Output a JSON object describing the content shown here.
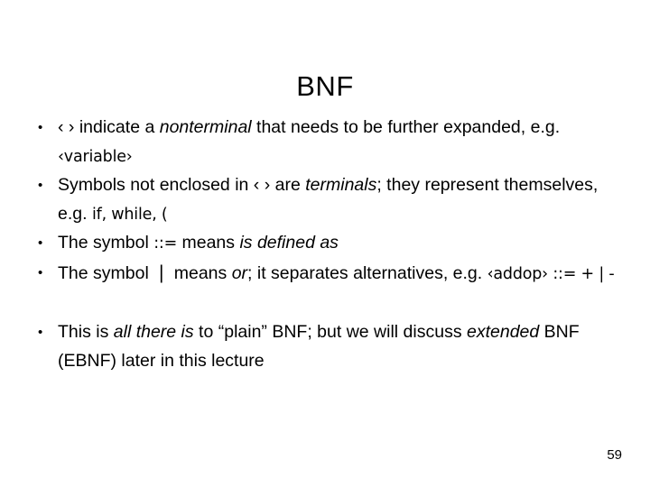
{
  "slide": {
    "title": "BNF",
    "page_number": "59",
    "background_color": "#ffffff",
    "text_color": "#000000"
  },
  "bullets": [
    {
      "id": "bullet-angle-brackets",
      "segments": [
        {
          "text": "‹ › ",
          "style": "angles"
        },
        {
          "text": "indicate a ",
          "style": "normal"
        },
        {
          "text": "nonterminal",
          "style": "italic"
        },
        {
          "text": " that needs to be further expanded, e.g. ",
          "style": "normal"
        },
        {
          "text": "‹variable›",
          "style": "mono"
        }
      ],
      "plain": "‹ › indicate a nonterminal that needs to be further expanded, e.g. ‹variable›"
    },
    {
      "id": "bullet-terminals",
      "segments": [
        {
          "text": "Symbols not enclosed in ",
          "style": "normal"
        },
        {
          "text": "‹ › ",
          "style": "angles"
        },
        {
          "text": "are ",
          "style": "normal"
        },
        {
          "text": "terminals",
          "style": "italic"
        },
        {
          "text": "; they represent themselves, e.g. ",
          "style": "normal"
        },
        {
          "text": "if, while, (",
          "style": "mono"
        }
      ],
      "plain": "Symbols not enclosed in ‹ › are terminals; they represent themselves, e.g. if, while, ("
    },
    {
      "id": "bullet-is-defined-as",
      "segments": [
        {
          "text": "The symbol ",
          "style": "normal"
        },
        {
          "text": "::=",
          "style": "mono"
        },
        {
          "text": " means ",
          "style": "normal"
        },
        {
          "text": "is defined as",
          "style": "italic"
        }
      ],
      "plain": "The symbol ::= means is defined as"
    },
    {
      "id": "bullet-or-alternatives",
      "segments": [
        {
          "text": "The symbol ",
          "style": "normal"
        },
        {
          "text": " | ",
          "style": "bar"
        },
        {
          "text": " means ",
          "style": "normal"
        },
        {
          "text": "or",
          "style": "italic"
        },
        {
          "text": "; it separates alternatives, e.g. ",
          "style": "normal"
        },
        {
          "text": "‹addop› ::= + | -",
          "style": "mono"
        }
      ],
      "plain": "The symbol | means or; it separates alternatives, e.g. ‹addop› ::= + | -"
    },
    {
      "id": "bullet-plain-vs-extended",
      "gap_before": true,
      "segments": [
        {
          "text": "This is ",
          "style": "normal"
        },
        {
          "text": "all there is",
          "style": "italic"
        },
        {
          "text": " to “plain” BNF; but we will discuss ",
          "style": "normal"
        },
        {
          "text": "extended",
          "style": "italic"
        },
        {
          "text": " BNF (EBNF) later in this lecture",
          "style": "normal"
        }
      ],
      "plain": "This is all there is to “plain” BNF; but we will discuss extended BNF (EBNF) later in this lecture"
    }
  ]
}
